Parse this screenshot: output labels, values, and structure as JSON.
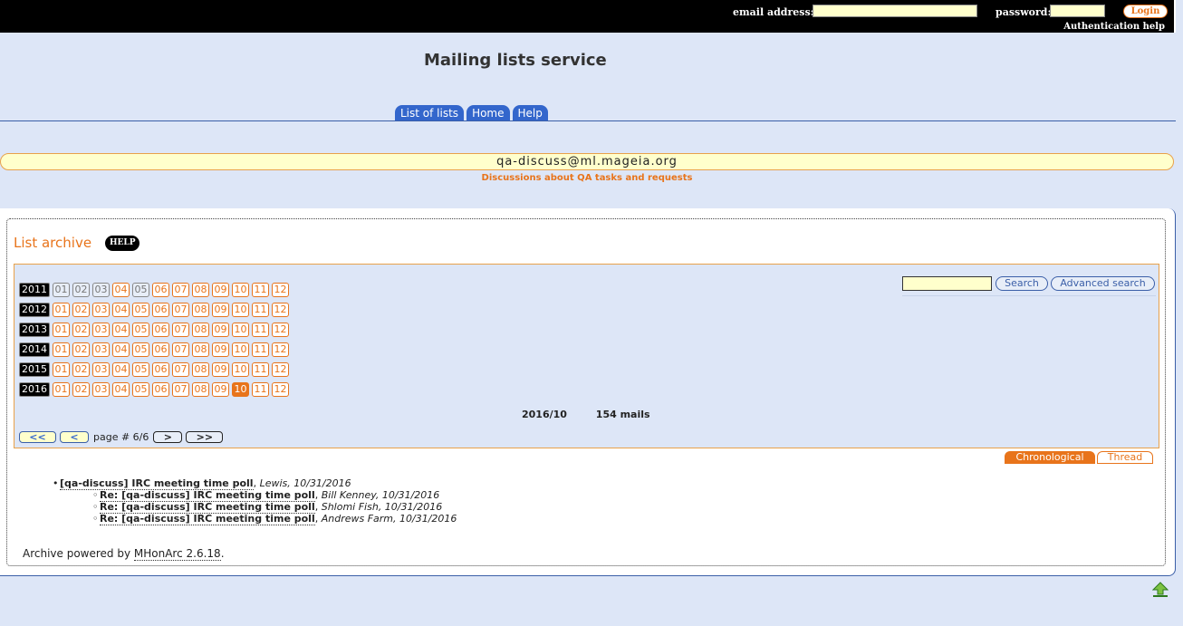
{
  "auth": {
    "email_label": "email address:",
    "password_label": "password:",
    "login_label": "Login",
    "help_link": "Authentication help"
  },
  "header": {
    "title": "Mailing lists service",
    "tabs": [
      {
        "label": "List of lists"
      },
      {
        "label": "Home"
      },
      {
        "label": "Help"
      }
    ]
  },
  "list": {
    "address": "qa-discuss@ml.mageia.org",
    "subject": "Discussions about QA tasks and requests"
  },
  "archive": {
    "heading": "List archive",
    "help_badge": "HELP",
    "years": [
      {
        "year": "2011",
        "months": [
          {
            "m": "01",
            "state": "empty"
          },
          {
            "m": "02",
            "state": "empty"
          },
          {
            "m": "03",
            "state": "empty"
          },
          {
            "m": "04",
            "state": "link"
          },
          {
            "m": "05",
            "state": "empty"
          },
          {
            "m": "06",
            "state": "link"
          },
          {
            "m": "07",
            "state": "link"
          },
          {
            "m": "08",
            "state": "link"
          },
          {
            "m": "09",
            "state": "link"
          },
          {
            "m": "10",
            "state": "link"
          },
          {
            "m": "11",
            "state": "link"
          },
          {
            "m": "12",
            "state": "link"
          }
        ]
      },
      {
        "year": "2012",
        "months": [
          {
            "m": "01",
            "state": "link"
          },
          {
            "m": "02",
            "state": "link"
          },
          {
            "m": "03",
            "state": "link"
          },
          {
            "m": "04",
            "state": "link"
          },
          {
            "m": "05",
            "state": "link"
          },
          {
            "m": "06",
            "state": "link"
          },
          {
            "m": "07",
            "state": "link"
          },
          {
            "m": "08",
            "state": "link"
          },
          {
            "m": "09",
            "state": "link"
          },
          {
            "m": "10",
            "state": "link"
          },
          {
            "m": "11",
            "state": "link"
          },
          {
            "m": "12",
            "state": "link"
          }
        ]
      },
      {
        "year": "2013",
        "months": [
          {
            "m": "01",
            "state": "link"
          },
          {
            "m": "02",
            "state": "link"
          },
          {
            "m": "03",
            "state": "link"
          },
          {
            "m": "04",
            "state": "link"
          },
          {
            "m": "05",
            "state": "link"
          },
          {
            "m": "06",
            "state": "link"
          },
          {
            "m": "07",
            "state": "link"
          },
          {
            "m": "08",
            "state": "link"
          },
          {
            "m": "09",
            "state": "link"
          },
          {
            "m": "10",
            "state": "link"
          },
          {
            "m": "11",
            "state": "link"
          },
          {
            "m": "12",
            "state": "link"
          }
        ]
      },
      {
        "year": "2014",
        "months": [
          {
            "m": "01",
            "state": "link"
          },
          {
            "m": "02",
            "state": "link"
          },
          {
            "m": "03",
            "state": "link"
          },
          {
            "m": "04",
            "state": "link"
          },
          {
            "m": "05",
            "state": "link"
          },
          {
            "m": "06",
            "state": "link"
          },
          {
            "m": "07",
            "state": "link"
          },
          {
            "m": "08",
            "state": "link"
          },
          {
            "m": "09",
            "state": "link"
          },
          {
            "m": "10",
            "state": "link"
          },
          {
            "m": "11",
            "state": "link"
          },
          {
            "m": "12",
            "state": "link"
          }
        ]
      },
      {
        "year": "2015",
        "months": [
          {
            "m": "01",
            "state": "link"
          },
          {
            "m": "02",
            "state": "link"
          },
          {
            "m": "03",
            "state": "link"
          },
          {
            "m": "04",
            "state": "link"
          },
          {
            "m": "05",
            "state": "link"
          },
          {
            "m": "06",
            "state": "link"
          },
          {
            "m": "07",
            "state": "link"
          },
          {
            "m": "08",
            "state": "link"
          },
          {
            "m": "09",
            "state": "link"
          },
          {
            "m": "10",
            "state": "link"
          },
          {
            "m": "11",
            "state": "link"
          },
          {
            "m": "12",
            "state": "link"
          }
        ]
      },
      {
        "year": "2016",
        "months": [
          {
            "m": "01",
            "state": "link"
          },
          {
            "m": "02",
            "state": "link"
          },
          {
            "m": "03",
            "state": "link"
          },
          {
            "m": "04",
            "state": "link"
          },
          {
            "m": "05",
            "state": "link"
          },
          {
            "m": "06",
            "state": "link"
          },
          {
            "m": "07",
            "state": "link"
          },
          {
            "m": "08",
            "state": "link"
          },
          {
            "m": "09",
            "state": "link"
          },
          {
            "m": "10",
            "state": "current"
          },
          {
            "m": "11",
            "state": "link"
          },
          {
            "m": "12",
            "state": "link"
          }
        ]
      }
    ],
    "search_button": "Search",
    "advanced_search_button": "Advanced search",
    "current_month": "2016/10",
    "mail_count": "154 mails",
    "pager": {
      "first": "<<",
      "prev": "<",
      "page_label": "page # 6/6",
      "next": ">",
      "last": ">>"
    },
    "views": {
      "chronological": "Chronological",
      "thread": "Thread"
    }
  },
  "messages": [
    {
      "subject": "[qa-discuss] IRC meeting time poll",
      "meta": "Lewis, 10/31/2016",
      "reply": false
    },
    {
      "subject": "Re: [qa-discuss] IRC meeting time poll",
      "meta": "Bill Kenney, 10/31/2016",
      "reply": true
    },
    {
      "subject": "Re: [qa-discuss] IRC meeting time poll",
      "meta": "Shlomi Fish, 10/31/2016",
      "reply": true
    },
    {
      "subject": "Re: [qa-discuss] IRC meeting time poll",
      "meta": "Andrews Farm, 10/31/2016",
      "reply": true
    }
  ],
  "footer": {
    "powered_prefix": "Archive powered by ",
    "powered_link": "MHonArc 2.6.18",
    "powered_suffix": "."
  },
  "icons": {
    "back_to_top": "up-arrow-icon"
  },
  "colors": {
    "accent": "#e8741b",
    "tab_blue": "#3366cc",
    "background": "#dde6f7",
    "highlight": "#ffffcc"
  }
}
